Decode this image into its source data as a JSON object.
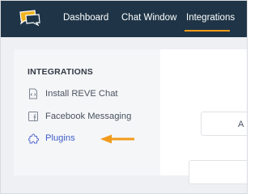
{
  "nav": {
    "logo": "reve-chat-logo",
    "items": [
      {
        "label": "Dashboard"
      },
      {
        "label": "Chat Window"
      },
      {
        "label": "Integrations",
        "active": true
      }
    ],
    "active_color": "#f29a1a",
    "background": "#1f3547"
  },
  "sidebar": {
    "title": "INTEGRATIONS",
    "items": [
      {
        "label": "Install REVE Chat",
        "icon": "code-doc-icon"
      },
      {
        "label": "Facebook Messaging",
        "icon": "facebook-icon"
      },
      {
        "label": "Plugins",
        "icon": "puzzle-icon",
        "highlighted": true
      }
    ]
  },
  "annotation": {
    "arrow_color": "#f29a1a",
    "points_to": "Plugins"
  },
  "content": {
    "partial_button_text": "A"
  }
}
